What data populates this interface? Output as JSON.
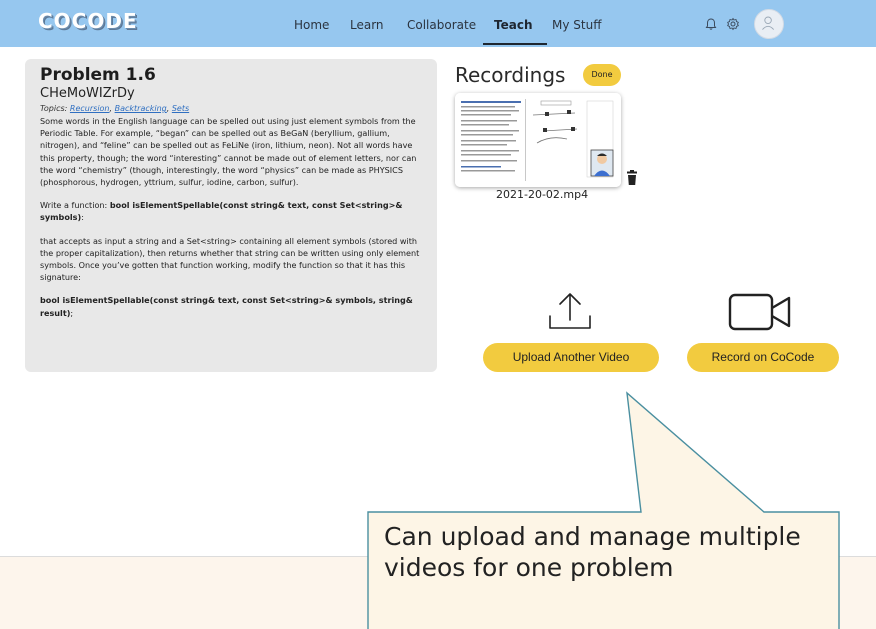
{
  "nav": {
    "logo": "COCODE",
    "links": [
      "Home",
      "Learn",
      "Collaborate",
      "Teach",
      "My Stuff"
    ],
    "active": "Teach",
    "icons": [
      "bell-icon",
      "gear-icon",
      "avatar"
    ]
  },
  "problem": {
    "title": "Problem 1.6",
    "code": "CHeMoWIZrDy",
    "topics_label": "Topics:",
    "topics": [
      "Recursion",
      "Backtracking",
      "Sets"
    ],
    "para1": "Some words in the English language can be spelled out using just element symbols from the Periodic Table. For example, “began” can be spelled out as BeGaN (beryllium, gallium, nitrogen), and “feline” can be spelled out as FeLiNe (iron, lithium, neon). Not all words have this property, though; the word “interesting” cannot be made out of element letters, nor can the word “chemistry” (though, interestingly, the word “physics” can be made as PHYSICS (phosphorous, hydrogen, yttrium, sulfur, iodine, carbon, sulfur).",
    "para2_prefix": "Write a function: ",
    "para2_bold": "bool isElementSpellable(const string& text, const Set<string>& symbols)",
    "para2_suffix": ":",
    "para3": "that accepts as input a string and a Set<string> containing all element symbols (stored with the proper capitalization), then returns whether that string can be written using only element symbols. Once you’ve gotten that function working, modify the function so that it has this signature:",
    "para4_bold": "bool isElementSpellable(const string& text, const Set<string>& symbols, string& result)",
    "para4_suffix": ";"
  },
  "recordings": {
    "title": "Recordings",
    "badge": "Done",
    "file_name": "2021-20-02.mp4",
    "upload_label": "Upload Another Video",
    "record_label": "Record on CoCode"
  },
  "callout": {
    "text": "Can upload and manage multiple videos for one problem"
  },
  "colors": {
    "nav_bg": "#96c7ef",
    "accent_yellow": "#f2cb3f",
    "panel_bg": "#e8e8e8",
    "callout_bg": "#fdf5e6",
    "callout_border": "#4a8fa0"
  }
}
